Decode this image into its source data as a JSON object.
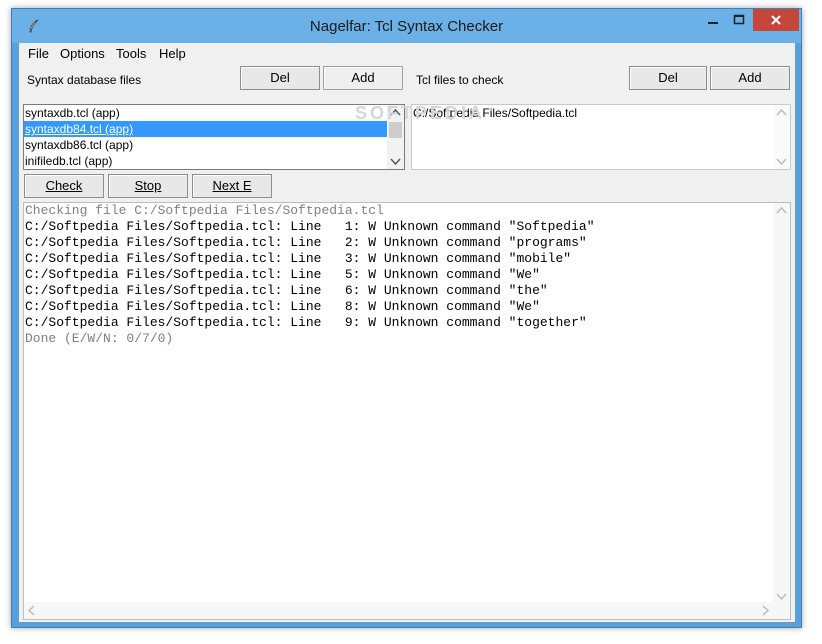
{
  "window": {
    "title": "Nagelfar: Tcl Syntax Checker"
  },
  "menu": {
    "items": [
      "File",
      "Options",
      "Tools",
      "Help"
    ]
  },
  "db_panel": {
    "label": "Syntax database files",
    "del_label": "Del",
    "add_label": "Add",
    "items": [
      "syntaxdb.tcl (app)",
      "syntaxdb84.tcl (app)",
      "syntaxdb86.tcl (app)",
      "inifiledb.tcl (app)"
    ],
    "selected_index": 1
  },
  "files_panel": {
    "label": "Tcl files to check",
    "del_label": "Del",
    "add_label": "Add",
    "items": [
      "C:/Softpedia Files/Softpedia.tcl"
    ]
  },
  "actions": {
    "check_label": "Check",
    "stop_label": "Stop",
    "next_label": "Next E"
  },
  "output": {
    "lines": [
      {
        "text": "Checking file C:/Softpedia Files/Softpedia.tcl",
        "style": "gray"
      },
      {
        "text": "C:/Softpedia Files/Softpedia.tcl: Line   1: W Unknown command \"Softpedia\"",
        "style": "normal"
      },
      {
        "text": "C:/Softpedia Files/Softpedia.tcl: Line   2: W Unknown command \"programs\"",
        "style": "normal"
      },
      {
        "text": "C:/Softpedia Files/Softpedia.tcl: Line   3: W Unknown command \"mobile\"",
        "style": "normal"
      },
      {
        "text": "C:/Softpedia Files/Softpedia.tcl: Line   5: W Unknown command \"We\"",
        "style": "normal"
      },
      {
        "text": "C:/Softpedia Files/Softpedia.tcl: Line   6: W Unknown command \"the\"",
        "style": "normal"
      },
      {
        "text": "C:/Softpedia Files/Softpedia.tcl: Line   8: W Unknown command \"We\"",
        "style": "normal"
      },
      {
        "text": "C:/Softpedia Files/Softpedia.tcl: Line   9: W Unknown command \"together\"",
        "style": "normal"
      },
      {
        "text": "Done (E/W/N: 0/7/0)",
        "style": "gray"
      }
    ]
  },
  "watermark": "SOFTPEDIA",
  "colors": {
    "titlebar": "#6bb0e6",
    "close_button": "#c7463a",
    "selection": "#3399ff",
    "gray_text": "#808080"
  }
}
